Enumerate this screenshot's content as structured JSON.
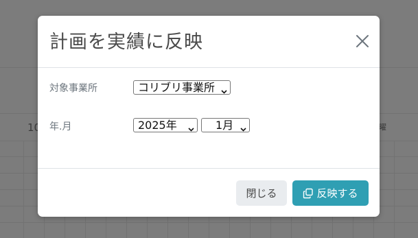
{
  "background": {
    "partial_text_left": "10",
    "partial_text_right": "曜"
  },
  "modal": {
    "title": "計画を実績に反映",
    "close_icon": "close-icon",
    "fields": {
      "office": {
        "label": "対象事業所",
        "selected": "コリブリ事業所"
      },
      "year_month": {
        "label": "年.月",
        "year_selected": "2025年",
        "month_selected": "1月"
      }
    },
    "footer": {
      "close_label": "閉じる",
      "reflect_label": "反映する",
      "reflect_icon": "copy-icon"
    },
    "colors": {
      "primary": "#2f9fb3",
      "secondary": "#e9ecef",
      "backdrop": "#7c7c7c"
    }
  }
}
